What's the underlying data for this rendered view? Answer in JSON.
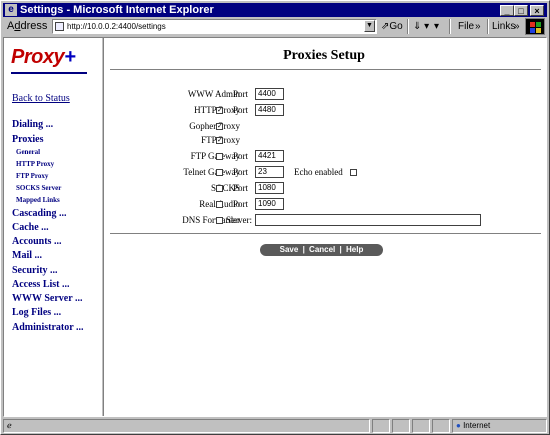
{
  "window": {
    "title": "Settings - Microsoft Internet Explorer"
  },
  "addressbar": {
    "label_prefix": "A",
    "label_underlined": "d",
    "label_suffix": "dress",
    "url": "http://10.0.0.2:4400/settings",
    "go_label": "Go",
    "file_label": "File",
    "links_label": "Links"
  },
  "sidebar": {
    "logo_text": "Proxy",
    "logo_plus": "+",
    "back_link": "Back to Status",
    "items": [
      {
        "label": "Dialing ..."
      },
      {
        "label": "Proxies"
      },
      {
        "label": "General"
      },
      {
        "label": "HTTP Proxy"
      },
      {
        "label": "FTP Proxy"
      },
      {
        "label": "SOCKS Server"
      },
      {
        "label": "Mapped Links"
      },
      {
        "label": "Cascading ..."
      },
      {
        "label": "Cache ..."
      },
      {
        "label": "Accounts ..."
      },
      {
        "label": "Mail ..."
      },
      {
        "label": "Security ..."
      },
      {
        "label": "Access List ..."
      },
      {
        "label": "WWW Server ..."
      },
      {
        "label": "Log Files ..."
      },
      {
        "label": "Administrator ..."
      }
    ]
  },
  "main": {
    "title": "Proxies Setup",
    "port_label": "Port",
    "server_label": "Server:",
    "echo_label": "Echo enabled",
    "rows": [
      {
        "label": "WWW Admin",
        "checked": null,
        "port": "4400"
      },
      {
        "label": "HTTP Proxy",
        "checked": true,
        "port": "4480"
      },
      {
        "label": "Gopher Proxy",
        "checked": true,
        "port": null
      },
      {
        "label": "FTP Proxy",
        "checked": true,
        "port": null
      },
      {
        "label": "FTP Gateway",
        "checked": false,
        "port": "4421"
      },
      {
        "label": "Telnet Gateway",
        "checked": false,
        "port": "23"
      },
      {
        "label": "SOCKS",
        "checked": false,
        "port": "1080"
      },
      {
        "label": "Real Audio",
        "checked": false,
        "port": "1090"
      },
      {
        "label": "DNS Forwarder",
        "checked": false,
        "server": ""
      }
    ],
    "buttons": {
      "save": "Save",
      "cancel": "Cancel",
      "help": "Help",
      "sep": "|"
    }
  },
  "statusbar": {
    "zone": "Internet"
  }
}
